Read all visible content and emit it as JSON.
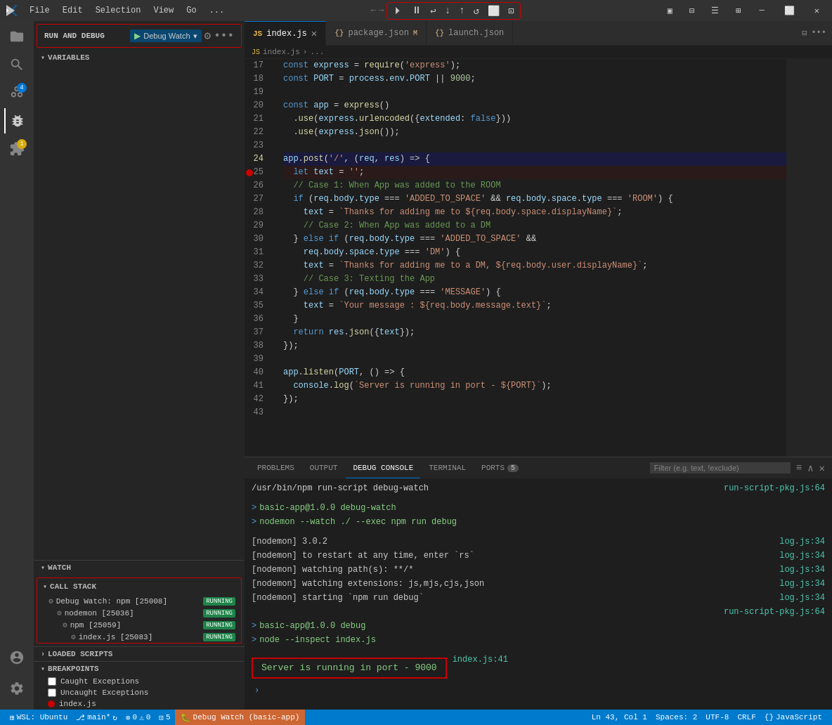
{
  "titleBar": {
    "menus": [
      "File",
      "Edit",
      "Selection",
      "View",
      "Go",
      "..."
    ],
    "debugControls": [
      "⏸",
      "⏵",
      "↩",
      "↓",
      "↑",
      "↺",
      "⬜",
      "⊡"
    ],
    "windowControls": [
      "—",
      "⬜",
      "✕"
    ]
  },
  "activityBar": {
    "icons": [
      {
        "name": "explorer-icon",
        "symbol": "⎘",
        "active": false
      },
      {
        "name": "search-icon",
        "symbol": "🔍",
        "active": false
      },
      {
        "name": "source-control-icon",
        "symbol": "⎇",
        "active": false,
        "badge": "4"
      },
      {
        "name": "debug-icon",
        "symbol": "🐛",
        "active": true
      },
      {
        "name": "extensions-icon",
        "symbol": "⊞",
        "active": false,
        "badge_warn": "1"
      },
      {
        "name": "remote-icon",
        "symbol": "⚙",
        "active": false,
        "badge_warn": "1"
      }
    ],
    "bottomIcons": [
      {
        "name": "account-icon",
        "symbol": "👤"
      },
      {
        "name": "settings-icon",
        "symbol": "⚙"
      }
    ]
  },
  "sidebar": {
    "runDebugTitle": "RUN AND DEBUG",
    "debugConfig": "Debug Watch",
    "sections": {
      "variables": "VARIABLES",
      "watch": "WATCH",
      "callStack": "CALL STACK",
      "loadedScripts": "LOADED SCRIPTS",
      "breakpoints": "BREAKPOINTS"
    },
    "callStackItems": [
      {
        "label": "Debug Watch: npm [25008]",
        "status": "RUNNING",
        "indent": 0
      },
      {
        "label": "nodemon [25036]",
        "status": "RUNNING",
        "indent": 1
      },
      {
        "label": "npm [25059]",
        "status": "RUNNING",
        "indent": 2
      },
      {
        "label": "index.js [25083]",
        "status": "RUNNING",
        "indent": 3
      }
    ],
    "breakpoints": [
      {
        "type": "checkbox",
        "label": "Caught Exceptions",
        "checked": false
      },
      {
        "type": "checkbox",
        "label": "Uncaught Exceptions",
        "checked": false
      },
      {
        "type": "dot",
        "label": "index.js",
        "lineNum": 25
      }
    ]
  },
  "tabs": [
    {
      "label": "index.js",
      "icon": "JS",
      "active": true,
      "closable": true
    },
    {
      "label": "package.json",
      "icon": "{}",
      "modified": true,
      "active": false,
      "closable": false
    },
    {
      "label": "launch.json",
      "icon": "{}",
      "active": false,
      "closable": false
    }
  ],
  "breadcrumb": [
    "index.js",
    ">",
    "..."
  ],
  "codeLines": [
    {
      "num": 17,
      "tokens": [
        {
          "t": "plain",
          "v": "const "
        },
        {
          "t": "var",
          "v": "express"
        },
        {
          "t": "plain",
          "v": " = "
        },
        {
          "t": "fn",
          "v": "require"
        },
        {
          "t": "plain",
          "v": "("
        },
        {
          "t": "str",
          "v": "'express'"
        },
        {
          "t": "plain",
          "v": ");"
        }
      ]
    },
    {
      "num": 18,
      "tokens": [
        {
          "t": "plain",
          "v": "const "
        },
        {
          "t": "var",
          "v": "PORT"
        },
        {
          "t": "plain",
          "v": " = "
        },
        {
          "t": "var",
          "v": "process"
        },
        {
          "t": "plain",
          "v": "."
        },
        {
          "t": "prop",
          "v": "env"
        },
        {
          "t": "plain",
          "v": "."
        },
        {
          "t": "prop",
          "v": "PORT"
        },
        {
          "t": "plain",
          "v": " || "
        },
        {
          "t": "num",
          "v": "9000"
        },
        {
          "t": "plain",
          "v": ";"
        }
      ]
    },
    {
      "num": 19,
      "tokens": []
    },
    {
      "num": 20,
      "tokens": [
        {
          "t": "plain",
          "v": "const "
        },
        {
          "t": "var",
          "v": "app"
        },
        {
          "t": "plain",
          "v": " = "
        },
        {
          "t": "fn",
          "v": "express"
        },
        {
          "t": "plain",
          "v": "()"
        }
      ]
    },
    {
      "num": 21,
      "tokens": [
        {
          "t": "plain",
          "v": "  ."
        },
        {
          "t": "fn",
          "v": "use"
        },
        {
          "t": "plain",
          "v": "("
        },
        {
          "t": "var",
          "v": "express"
        },
        {
          "t": "plain",
          "v": "."
        },
        {
          "t": "fn",
          "v": "urlencoded"
        },
        {
          "t": "plain",
          "v": "({"
        },
        {
          "t": "var",
          "v": "extended"
        },
        {
          "t": "plain",
          "v": ": "
        },
        {
          "t": "kw",
          "v": "false"
        },
        {
          "t": "plain",
          "v": "}))"
        }
      ]
    },
    {
      "num": 22,
      "tokens": [
        {
          "t": "plain",
          "v": "  ."
        },
        {
          "t": "fn",
          "v": "use"
        },
        {
          "t": "plain",
          "v": "("
        },
        {
          "t": "var",
          "v": "express"
        },
        {
          "t": "plain",
          "v": "."
        },
        {
          "t": "fn",
          "v": "json"
        },
        {
          "t": "plain",
          "v": "());"
        }
      ]
    },
    {
      "num": 23,
      "tokens": []
    },
    {
      "num": 24,
      "tokens": [
        {
          "t": "var",
          "v": "app"
        },
        {
          "t": "plain",
          "v": "."
        },
        {
          "t": "fn",
          "v": "post"
        },
        {
          "t": "plain",
          "v": "("
        },
        {
          "t": "str",
          "v": "'/'"
        },
        {
          "t": "plain",
          "v": ", ("
        },
        {
          "t": "var",
          "v": "req"
        },
        {
          "t": "plain",
          "v": ", "
        },
        {
          "t": "var",
          "v": "res"
        },
        {
          "t": "plain",
          "v": ") => {"
        }
      ],
      "highlight": true
    },
    {
      "num": 25,
      "tokens": [
        {
          "t": "plain",
          "v": "  "
        },
        {
          "t": "kw",
          "v": "let"
        },
        {
          "t": "plain",
          "v": " "
        },
        {
          "t": "var",
          "v": "text"
        },
        {
          "t": "plain",
          "v": " = "
        },
        {
          "t": "str",
          "v": "'';"
        }
      ],
      "breakpoint": true
    },
    {
      "num": 26,
      "tokens": [
        {
          "t": "plain",
          "v": "  "
        },
        {
          "t": "cm",
          "v": "// Case 1: When App was added to the ROOM"
        }
      ]
    },
    {
      "num": 27,
      "tokens": [
        {
          "t": "plain",
          "v": "  "
        },
        {
          "t": "kw",
          "v": "if"
        },
        {
          "t": "plain",
          "v": " ("
        },
        {
          "t": "var",
          "v": "req"
        },
        {
          "t": "plain",
          "v": "."
        },
        {
          "t": "prop",
          "v": "body"
        },
        {
          "t": "plain",
          "v": "."
        },
        {
          "t": "prop",
          "v": "type"
        },
        {
          "t": "plain",
          "v": " === "
        },
        {
          "t": "str",
          "v": "'ADDED_TO_SPACE'"
        },
        {
          "t": "plain",
          "v": " && "
        },
        {
          "t": "var",
          "v": "req"
        },
        {
          "t": "plain",
          "v": "."
        },
        {
          "t": "prop",
          "v": "body"
        },
        {
          "t": "plain",
          "v": "."
        },
        {
          "t": "prop",
          "v": "space"
        },
        {
          "t": "plain",
          "v": "."
        },
        {
          "t": "prop",
          "v": "type"
        },
        {
          "t": "plain",
          "v": " === "
        },
        {
          "t": "str",
          "v": "'ROOM'"
        },
        {
          "t": "plain",
          "v": ") {"
        }
      ]
    },
    {
      "num": 28,
      "tokens": [
        {
          "t": "plain",
          "v": "    "
        },
        {
          "t": "var",
          "v": "text"
        },
        {
          "t": "plain",
          "v": " = "
        },
        {
          "t": "tmpl",
          "v": "`Thanks for adding me to ${req.body.space.displayName}`;"
        }
      ]
    },
    {
      "num": 29,
      "tokens": [
        {
          "t": "plain",
          "v": "    "
        },
        {
          "t": "cm",
          "v": "// Case 2: When App was added to a DM"
        }
      ]
    },
    {
      "num": 30,
      "tokens": [
        {
          "t": "plain",
          "v": "  } "
        },
        {
          "t": "kw",
          "v": "else if"
        },
        {
          "t": "plain",
          "v": " ("
        },
        {
          "t": "var",
          "v": "req"
        },
        {
          "t": "plain",
          "v": "."
        },
        {
          "t": "prop",
          "v": "body"
        },
        {
          "t": "plain",
          "v": "."
        },
        {
          "t": "prop",
          "v": "type"
        },
        {
          "t": "plain",
          "v": " === "
        },
        {
          "t": "str",
          "v": "'ADDED_TO_SPACE'"
        },
        {
          "t": "plain",
          "v": " &&"
        }
      ]
    },
    {
      "num": 31,
      "tokens": [
        {
          "t": "plain",
          "v": "    "
        },
        {
          "t": "var",
          "v": "req"
        },
        {
          "t": "plain",
          "v": "."
        },
        {
          "t": "prop",
          "v": "body"
        },
        {
          "t": "plain",
          "v": "."
        },
        {
          "t": "prop",
          "v": "space"
        },
        {
          "t": "plain",
          "v": "."
        },
        {
          "t": "prop",
          "v": "type"
        },
        {
          "t": "plain",
          "v": " === "
        },
        {
          "t": "str",
          "v": "'DM'"
        },
        {
          "t": "plain",
          "v": ") {"
        }
      ]
    },
    {
      "num": 32,
      "tokens": [
        {
          "t": "plain",
          "v": "    "
        },
        {
          "t": "var",
          "v": "text"
        },
        {
          "t": "plain",
          "v": " = "
        },
        {
          "t": "tmpl",
          "v": "`Thanks for adding me to a DM, ${req.body.user.displayName}`;"
        }
      ]
    },
    {
      "num": 33,
      "tokens": [
        {
          "t": "plain",
          "v": "    "
        },
        {
          "t": "cm",
          "v": "// Case 3: Texting the App"
        }
      ]
    },
    {
      "num": 34,
      "tokens": [
        {
          "t": "plain",
          "v": "  } "
        },
        {
          "t": "kw",
          "v": "else if"
        },
        {
          "t": "plain",
          "v": " ("
        },
        {
          "t": "var",
          "v": "req"
        },
        {
          "t": "plain",
          "v": "."
        },
        {
          "t": "prop",
          "v": "body"
        },
        {
          "t": "plain",
          "v": "."
        },
        {
          "t": "prop",
          "v": "type"
        },
        {
          "t": "plain",
          "v": " === "
        },
        {
          "t": "str",
          "v": "'MESSAGE'"
        },
        {
          "t": "plain",
          "v": ") {"
        }
      ]
    },
    {
      "num": 35,
      "tokens": [
        {
          "t": "plain",
          "v": "    "
        },
        {
          "t": "var",
          "v": "text"
        },
        {
          "t": "plain",
          "v": " = "
        },
        {
          "t": "tmpl",
          "v": "`Your message : ${req.body.message.text}`;"
        }
      ]
    },
    {
      "num": 36,
      "tokens": [
        {
          "t": "plain",
          "v": "  }"
        }
      ]
    },
    {
      "num": 37,
      "tokens": [
        {
          "t": "plain",
          "v": "  "
        },
        {
          "t": "kw",
          "v": "return"
        },
        {
          "t": "plain",
          "v": " "
        },
        {
          "t": "var",
          "v": "res"
        },
        {
          "t": "plain",
          "v": "."
        },
        {
          "t": "fn",
          "v": "json"
        },
        {
          "t": "plain",
          "v": "({"
        },
        {
          "t": "var",
          "v": "text"
        },
        {
          "t": "plain",
          "v": "});"
        }
      ]
    },
    {
      "num": 38,
      "tokens": [
        {
          "t": "plain",
          "v": "});"
        }
      ]
    },
    {
      "num": 39,
      "tokens": []
    },
    {
      "num": 40,
      "tokens": [
        {
          "t": "var",
          "v": "app"
        },
        {
          "t": "plain",
          "v": "."
        },
        {
          "t": "fn",
          "v": "listen"
        },
        {
          "t": "plain",
          "v": "("
        },
        {
          "t": "var",
          "v": "PORT"
        },
        {
          "t": "plain",
          "v": ", () => {"
        }
      ]
    },
    {
      "num": 41,
      "tokens": [
        {
          "t": "plain",
          "v": "  "
        },
        {
          "t": "var",
          "v": "console"
        },
        {
          "t": "plain",
          "v": "."
        },
        {
          "t": "fn",
          "v": "log"
        },
        {
          "t": "plain",
          "v": "("
        },
        {
          "t": "tmpl",
          "v": "`Server is running in port - ${PORT}`;"
        }
      ]
    },
    {
      "num": 42,
      "tokens": [
        {
          "t": "plain",
          "v": "});"
        }
      ]
    },
    {
      "num": 43,
      "tokens": []
    }
  ],
  "panel": {
    "tabs": [
      "PROBLEMS",
      "OUTPUT",
      "DEBUG CONSOLE",
      "TERMINAL",
      "PORTS"
    ],
    "activeTab": "DEBUG CONSOLE",
    "portsBadge": "5",
    "filterPlaceholder": "Filter (e.g. text, !exclude)",
    "consoleLines": [
      {
        "text": "/usr/bin/npm run-script debug-watch",
        "link": "run-script-pkg.js:64",
        "color": "plain"
      },
      {
        "text": "",
        "link": "",
        "color": "plain"
      },
      {
        "text": "> basic-app@1.0.0 debug-watch",
        "link": "",
        "color": "green"
      },
      {
        "text": "> nodemon --watch ./ --exec npm run debug",
        "link": "",
        "color": "green"
      },
      {
        "text": "",
        "link": "",
        "color": "plain"
      },
      {
        "text": "[nodemon] 3.0.2",
        "link": "log.js:34",
        "color": "plain"
      },
      {
        "text": "[nodemon] to restart at any time, enter `rs`",
        "link": "log.js:34",
        "color": "plain"
      },
      {
        "text": "[nodemon] watching path(s): **/*",
        "link": "log.js:34",
        "color": "plain"
      },
      {
        "text": "[nodemon] watching extensions: js,mjs,cjs,json",
        "link": "log.js:34",
        "color": "plain"
      },
      {
        "text": "[nodemon] starting `npm run debug`",
        "link": "log.js:34",
        "color": "plain"
      },
      {
        "text": "",
        "link": "run-script-pkg.js:64",
        "color": "plain"
      },
      {
        "text": "> basic-app@1.0.0 debug",
        "link": "",
        "color": "green"
      },
      {
        "text": "> node --inspect index.js",
        "link": "",
        "color": "green"
      },
      {
        "text": "",
        "link": "",
        "color": "plain"
      },
      {
        "text": "Server is running in port - 9000",
        "link": "index.js:41",
        "highlighted": true
      }
    ]
  },
  "statusBar": {
    "wsl": "WSL: Ubuntu",
    "git": "main*",
    "errors": "0",
    "warnings": "0",
    "debug": "Debug Watch (basic-app)",
    "position": "Ln 43, Col 1",
    "spaces": "Spaces: 2",
    "encoding": "UTF-8",
    "lineEnding": "CRLF",
    "language": "JavaScript",
    "ports": "5"
  }
}
